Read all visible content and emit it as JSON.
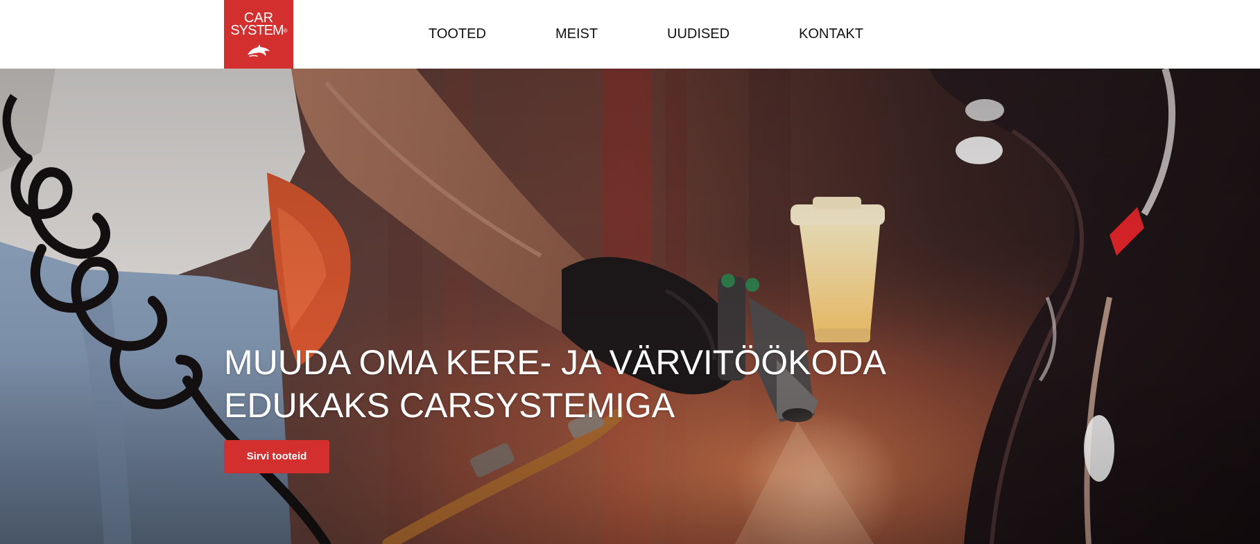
{
  "brand": {
    "logo_line1": "CAR",
    "logo_line2": "SYSTEM",
    "logo_mark": "®",
    "logo_icon": "dolphin-icon",
    "color": "#d32f2f"
  },
  "nav": {
    "items": [
      {
        "label": "TOOTED"
      },
      {
        "label": "MEIST"
      },
      {
        "label": "UUDISED"
      },
      {
        "label": "KONTAKT"
      }
    ]
  },
  "hero": {
    "title_line1": "MUUDA OMA KERE- JA VÄRVITÖÖKODA",
    "title_line2": "EDUKAKS CARSYSTEMIGA",
    "cta_label": "Sirvi tooteid",
    "accent_color": "#d32f2f"
  }
}
